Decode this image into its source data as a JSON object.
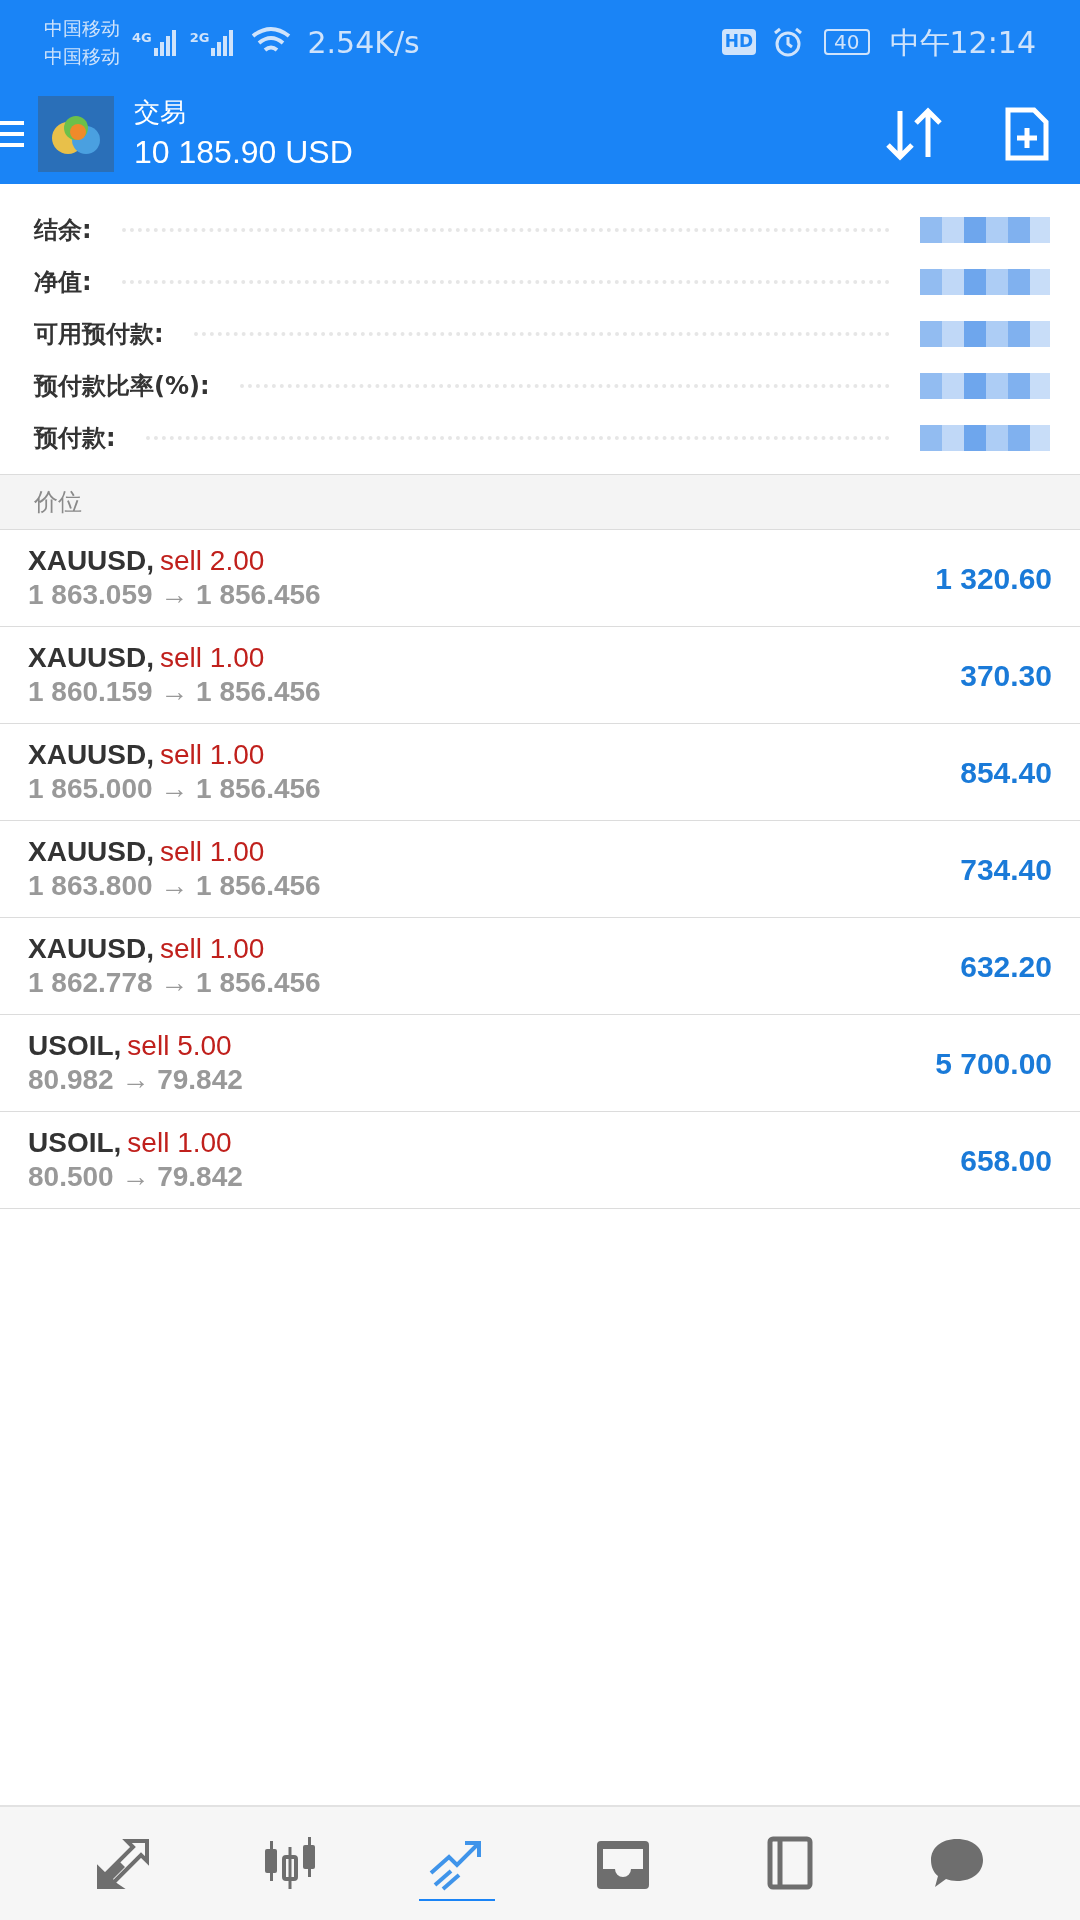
{
  "status_bar": {
    "carriers": [
      "中国移动",
      "中国移动"
    ],
    "network_types": [
      "4G",
      "2G"
    ],
    "speed": "2.54K/s",
    "hd": "HD",
    "battery": "40",
    "time": "中午12:14"
  },
  "header": {
    "title": "交易",
    "balance": "10 185.90 USD"
  },
  "account": [
    {
      "label": "结余:"
    },
    {
      "label": "净值:"
    },
    {
      "label": "可用预付款:"
    },
    {
      "label": "预付款比率(%):"
    },
    {
      "label": "预付款:"
    }
  ],
  "section": {
    "title": "价位"
  },
  "positions": [
    {
      "symbol": "XAUUSD,",
      "side": "sell 2.00",
      "prices": "1 863.059 → 1 856.456",
      "profit": "1 320.60"
    },
    {
      "symbol": "XAUUSD,",
      "side": "sell 1.00",
      "prices": "1 860.159 → 1 856.456",
      "profit": "370.30"
    },
    {
      "symbol": "XAUUSD,",
      "side": "sell 1.00",
      "prices": "1 865.000 → 1 856.456",
      "profit": "854.40"
    },
    {
      "symbol": "XAUUSD,",
      "side": "sell 1.00",
      "prices": "1 863.800 → 1 856.456",
      "profit": "734.40"
    },
    {
      "symbol": "XAUUSD,",
      "side": "sell 1.00",
      "prices": "1 862.778 → 1 856.456",
      "profit": "632.20"
    },
    {
      "symbol": "USOIL,",
      "side": "sell 5.00",
      "prices": "80.982 → 79.842",
      "profit": "5 700.00"
    },
    {
      "symbol": "USOIL,",
      "side": "sell 1.00",
      "prices": "80.500 → 79.842",
      "profit": "658.00"
    }
  ],
  "nav": [
    {
      "kind": "quotes",
      "selected": false
    },
    {
      "kind": "chart",
      "selected": false
    },
    {
      "kind": "trade",
      "selected": true
    },
    {
      "kind": "news",
      "selected": false
    },
    {
      "kind": "history",
      "selected": false
    },
    {
      "kind": "chat",
      "selected": false
    }
  ]
}
